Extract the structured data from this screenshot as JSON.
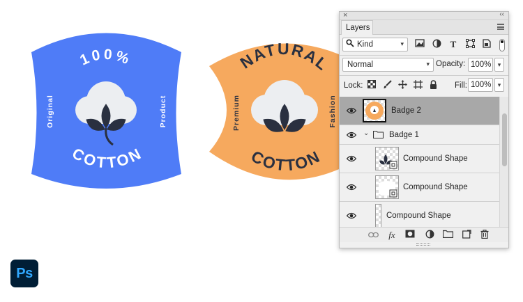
{
  "canvas": {
    "badge1": {
      "color": "#4f7cf7",
      "top_text": "100%",
      "bottom_text": "COTTON",
      "left_text": "Original",
      "right_text": "Product"
    },
    "badge2": {
      "color": "#f6a95e",
      "top_text": "NATURAL",
      "bottom_text": "COTTON",
      "left_text": "Premium",
      "right_text": "Fashion"
    },
    "icon_colors": {
      "boll": "#eceef1",
      "leaves": "#2a3040"
    },
    "text_dark": "#2a3040",
    "app_logo": "Ps"
  },
  "panel": {
    "tab_label": "Layers",
    "filter": {
      "kind_label": "Kind",
      "icons": [
        "image-filter-icon",
        "adjustment-filter-icon",
        "type-filter-icon",
        "shape-filter-icon",
        "smart-object-filter-icon"
      ]
    },
    "blend_mode": "Normal",
    "opacity_label": "Opacity:",
    "opacity_value": "100%",
    "lock_label": "Lock:",
    "fill_label": "Fill:",
    "fill_value": "100%",
    "layers": [
      {
        "name": "Badge 2",
        "selected": true,
        "type": "layer"
      },
      {
        "name": "Badge 1",
        "selected": false,
        "type": "group"
      },
      {
        "name": "Compound Shape",
        "selected": false,
        "type": "shape"
      },
      {
        "name": "Compound Shape",
        "selected": false,
        "type": "shape"
      },
      {
        "name": "Compound Shape",
        "selected": false,
        "type": "shape"
      }
    ],
    "bottom_icons": [
      "link-icon",
      "fx-icon",
      "mask-icon",
      "adjustment-icon",
      "folder-icon",
      "new-layer-icon",
      "trash-icon"
    ],
    "fx_label": "fx"
  }
}
